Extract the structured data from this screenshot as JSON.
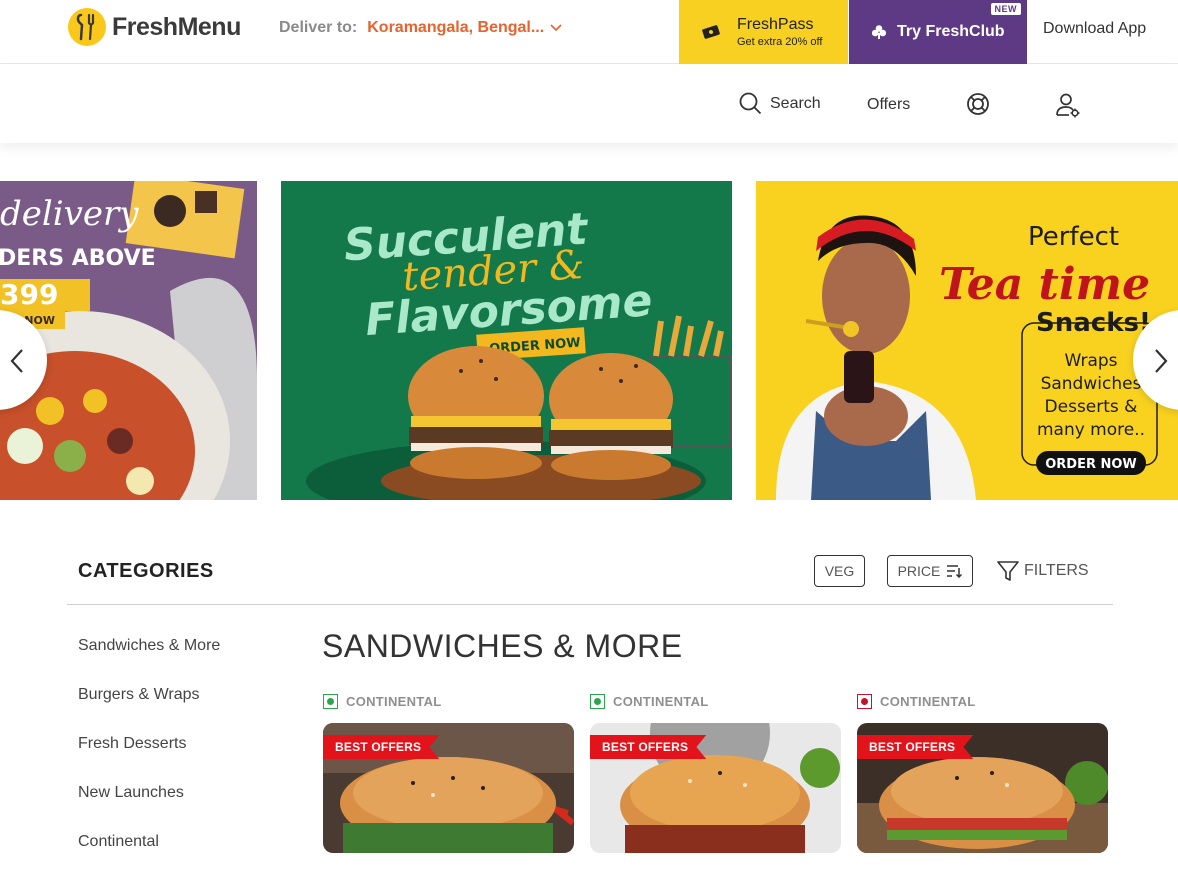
{
  "header": {
    "brand": "FreshMenu",
    "deliver_label": "Deliver to:",
    "deliver_location": "Koramangala, Bengal...",
    "freshpass_title": "FreshPass",
    "freshpass_sub": "Get extra 20% off",
    "freshclub_label": "Try FreshClub",
    "freshclub_badge": "NEW",
    "download_label": "Download App"
  },
  "nav": {
    "search_label": "Search",
    "offers_label": "Offers"
  },
  "banners": {
    "b1": {
      "line1": "delivery",
      "line2": "DERS ABOVE",
      "line3": "399",
      "cta": "R NOW"
    },
    "b2": {
      "line1": "Succulent",
      "line2": "tender &",
      "line3": "Flavorsome",
      "cta": "ORDER NOW"
    },
    "b3": {
      "line1": "Perfect",
      "line2": "Tea time",
      "line3": "Snacks!",
      "list": [
        "Wraps",
        "Sandwiches",
        "Desserts &",
        "many more.."
      ],
      "cta": "ORDER NOW"
    }
  },
  "filters": {
    "categories_title": "CATEGORIES",
    "veg_label": "VEG",
    "price_label": "PRICE",
    "filters_label": "FILTERS"
  },
  "sidebar": {
    "items": [
      {
        "label": "Sandwiches & More"
      },
      {
        "label": "Burgers & Wraps"
      },
      {
        "label": "Fresh Desserts"
      },
      {
        "label": "New Launches"
      },
      {
        "label": "Continental"
      }
    ]
  },
  "section": {
    "title": "SANDWICHES & MORE"
  },
  "cards": [
    {
      "cuisine": "CONTINENTAL",
      "badge": "BEST OFFERS",
      "diet": "veg"
    },
    {
      "cuisine": "CONTINENTAL",
      "badge": "BEST OFFERS",
      "diet": "veg"
    },
    {
      "cuisine": "CONTINENTAL",
      "badge": "BEST OFFERS",
      "diet": "non-veg"
    }
  ],
  "colors": {
    "accent": "#e8632c",
    "freshpass": "#f7d021",
    "freshclub": "#5d3a83",
    "veg": "#2da44e",
    "nonveg": "#c8102e",
    "badge": "#e3131b"
  }
}
